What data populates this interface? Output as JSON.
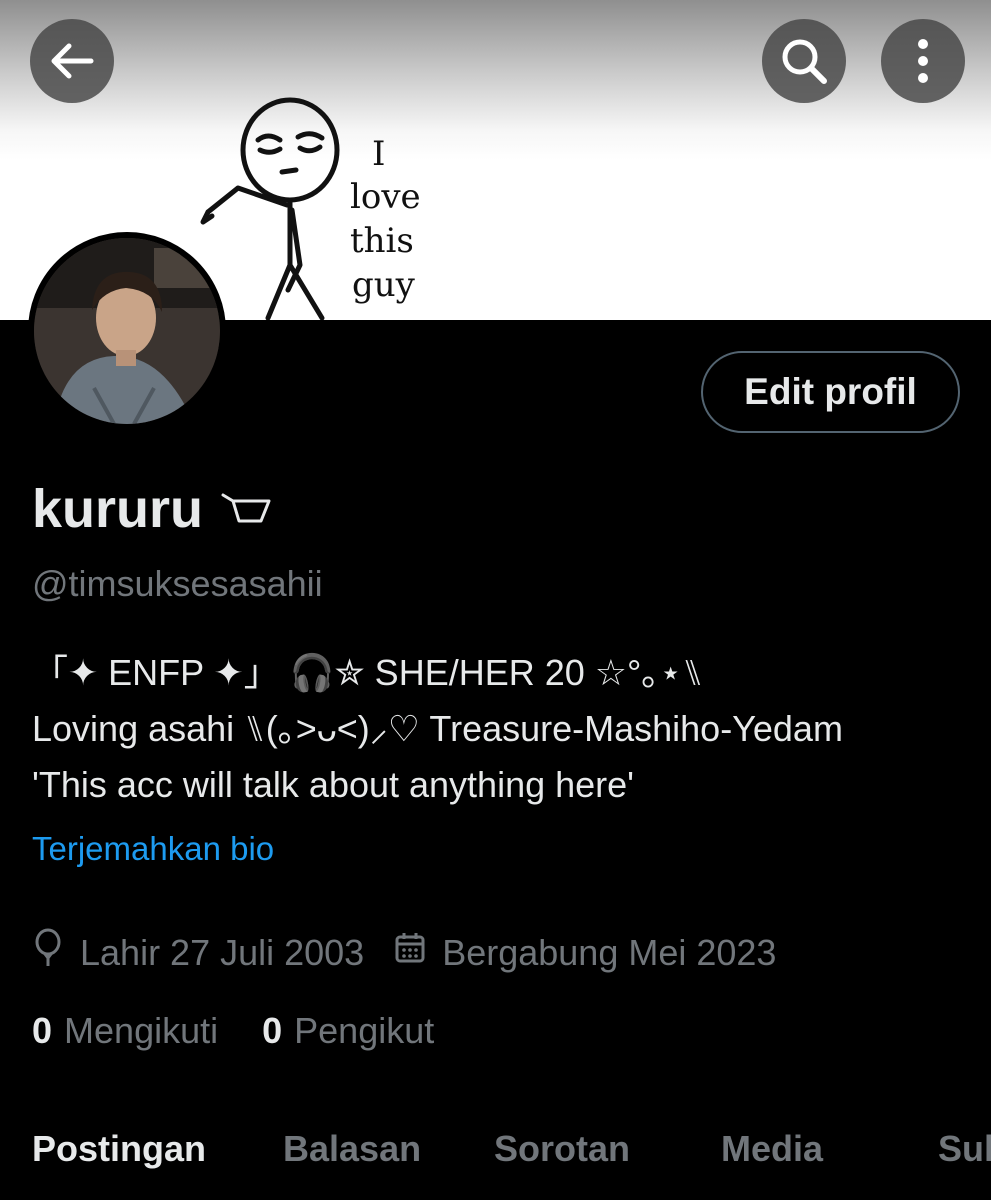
{
  "banner": {
    "caption_lines": [
      "I",
      "love",
      "this",
      "guy"
    ]
  },
  "header": {
    "back_icon": "arrow-left-icon",
    "search_icon": "search-icon",
    "more_icon": "more-vertical-icon"
  },
  "profile": {
    "edit_label": "Edit profil",
    "display_name": "kururu",
    "name_icon": "basket-icon",
    "handle": "@timsuksesasahii",
    "bio_lines": [
      "「✦ ENFP ✦」 🎧✮ SHE/HER 20 ☆°｡⋆⑊",
      "Loving asahi ⑊(｡>ᴗ<)⸝♡ Treasure-Mashiho-Yedam",
      "'This acc will talk about anything here'"
    ],
    "translate_label": "Terjemahkan bio",
    "birthday_icon": "balloon-icon",
    "birthday": "Lahir 27 Juli 2003",
    "joined_icon": "calendar-icon",
    "joined": "Bergabung Mei 2023",
    "following_count": "0",
    "following_label": "Mengikuti",
    "followers_count": "0",
    "followers_label": "Pengikut"
  },
  "tabs": [
    "Postingan",
    "Balasan",
    "Sorotan",
    "Media",
    "Suka"
  ],
  "colors": {
    "background": "#000000",
    "text_primary": "#e7e9ea",
    "text_secondary": "#71767b",
    "link": "#1d9bf0",
    "button_border": "#536471"
  }
}
